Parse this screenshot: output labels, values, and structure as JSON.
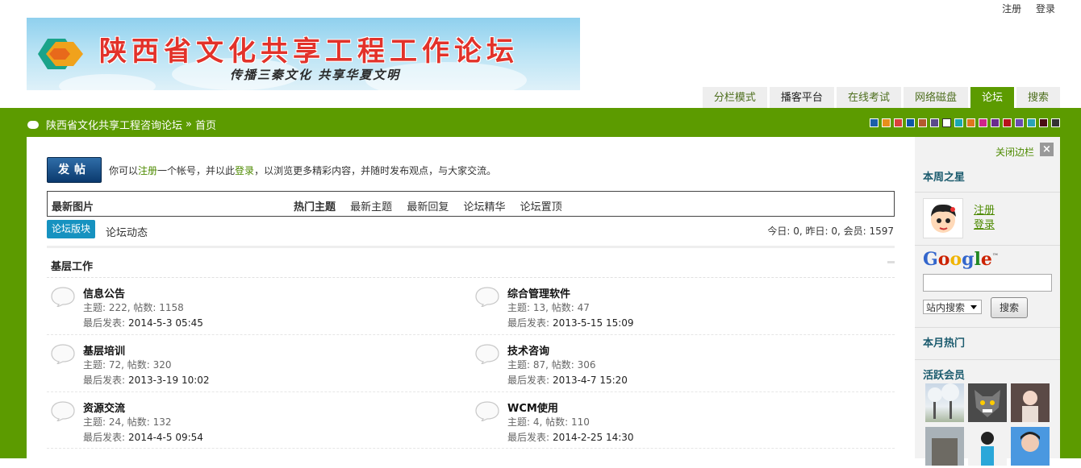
{
  "top_links": {
    "register": "注册",
    "login": "登录"
  },
  "banner": {
    "title": "陕西省文化共享工程工作论坛",
    "subtitle": "传播三秦文化 共享华夏文明"
  },
  "nav_tabs": [
    "分栏模式",
    "播客平台",
    "在线考试",
    "网络磁盘",
    "论坛",
    "搜索"
  ],
  "nav_active": "论坛",
  "breadcrumb": {
    "forum": "陕西省文化共享工程咨询论坛",
    "separator": "»",
    "home": "首页"
  },
  "color_swatches": [
    "#1b5fa8",
    "#e88f1b",
    "#d9413b",
    "#0d57a6",
    "#b35a2e",
    "#5a4a8a",
    "#ffffff",
    "#19a7b2",
    "#e0761e",
    "#d0248a",
    "#6a2c8e",
    "#b8121b",
    "#6b4bb0",
    "#2aa3b7",
    "#4a0f12",
    "#333333"
  ],
  "post_button": "发帖",
  "notice": {
    "pre": "你可以",
    "register": "注册",
    "mid": "一个帐号，并以此",
    "login": "登录",
    "post": "，以浏览更多精彩内容，并随时发布观点，与大家交流。"
  },
  "tabbox": {
    "left": "最新图片",
    "items": [
      "热门主题",
      "最新主题",
      "最新回复",
      "论坛精华",
      "论坛置顶"
    ]
  },
  "subtabs": {
    "active": "论坛版块",
    "other": "论坛动态"
  },
  "stats": "今日: 0, 昨日: 0, 会员: 1597",
  "section_title": "基层工作",
  "forums": [
    {
      "name": "信息公告",
      "stat": "主题: 222, 帖数: 1158",
      "last_label": "最后发表:",
      "last": "2014-5-3 05:45"
    },
    {
      "name": "综合管理软件",
      "stat": "主题: 13, 帖数: 47",
      "last_label": "最后发表:",
      "last": "2013-5-15 15:09"
    },
    {
      "name": "基层培训",
      "stat": "主题: 72, 帖数: 320",
      "last_label": "最后发表:",
      "last": "2013-3-19 10:02"
    },
    {
      "name": "技术咨询",
      "stat": "主题: 87, 帖数: 306",
      "last_label": "最后发表:",
      "last": "2013-4-7 15:20"
    },
    {
      "name": "资源交流",
      "stat": "主题: 24, 帖数: 132",
      "last_label": "最后发表:",
      "last": "2014-4-5 09:54"
    },
    {
      "name": "WCM使用",
      "stat": "主题: 4, 帖数: 110",
      "last_label": "最后发表:",
      "last": "2014-2-25 14:30"
    }
  ],
  "sidebar": {
    "close": "关闭边栏",
    "close_x": "×",
    "star_title": "本周之星",
    "register": "注册",
    "login": "登录",
    "google": {
      "G": "G",
      "o1": "o",
      "o2": "o",
      "g": "g",
      "l": "l",
      "e": "e",
      "tm": "™"
    },
    "search_option": "站内搜索",
    "search_button": "搜索",
    "month_hot": "本月热门",
    "active_members": "活跃会员"
  }
}
